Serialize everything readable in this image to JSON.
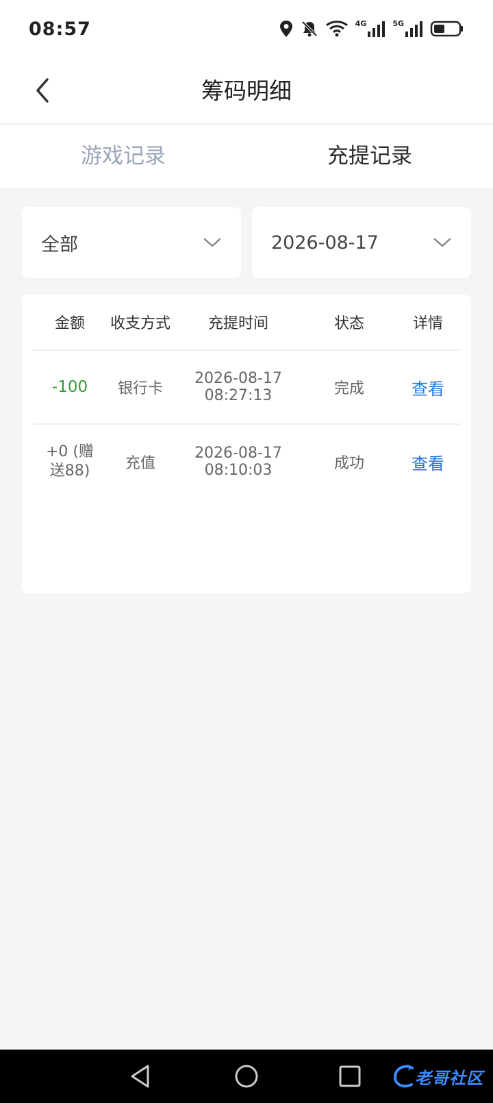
{
  "status_bar": {
    "time": "08:57",
    "network_1": "4G",
    "network_2": "5G",
    "icons": [
      "location-icon",
      "bell-muted-icon",
      "wifi-icon",
      "signal-icon",
      "signal-icon",
      "battery-icon"
    ]
  },
  "nav": {
    "title": "筹码明细",
    "back_icon": "chevron-left-icon"
  },
  "tabs": [
    {
      "label": "游戏记录",
      "active": false
    },
    {
      "label": "充提记录",
      "active": true
    }
  ],
  "filters": {
    "type": "全部",
    "date": "2026-08-17"
  },
  "table": {
    "headers": [
      "金额",
      "收支方式",
      "充提时间",
      "状态",
      "详情"
    ],
    "rows": [
      {
        "amount": "-100",
        "method": "银行卡",
        "date": "2026-08-17",
        "time": "08:27:13",
        "status": "完成",
        "detail": "查看"
      },
      {
        "amount_line1": "+0 (赠",
        "amount_line2": "送88)",
        "method": "充值",
        "date": "2026-08-17",
        "time": "08:10:03",
        "status": "成功",
        "detail": "查看"
      }
    ]
  },
  "watermark": {
    "text": "老哥社区"
  },
  "colors": {
    "negative_amount": "#3a9a3a",
    "positive_amount": "#d8433b",
    "link": "#2677d9",
    "inactive_tab": "#9aa5b8"
  }
}
